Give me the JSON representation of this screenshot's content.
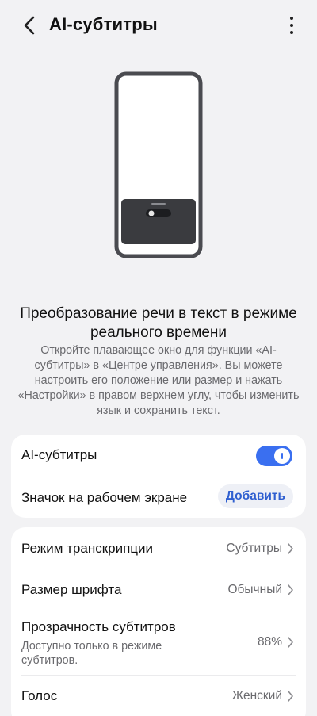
{
  "header": {
    "title": "AI-субтитры",
    "back_icon": "chevron-left-icon",
    "more_icon": "more-vertical-icon"
  },
  "intro": {
    "heading": "Преобразование речи в текст в режиме реального времени",
    "description": "Откройте плавающее окно для функции «AI-субтитры» в «Центре управления». Вы можете настроить его положение или размер и нажать «Настройки» в правом верхнем углу, чтобы изменить язык и сохранить текст."
  },
  "card1": {
    "ai_subtitles": {
      "label": "AI-субтитры",
      "enabled": true
    },
    "home_icon": {
      "label": "Значок на рабочем экране",
      "button": "Добавить"
    }
  },
  "card2": {
    "items": [
      {
        "label": "Режим транскрипции",
        "value": "Субтитры"
      },
      {
        "label": "Размер шрифта",
        "value": "Обычный"
      },
      {
        "label": "Прозрачность субтитров",
        "sublabel": "Доступно только в режиме субтитров.",
        "value": "88%"
      },
      {
        "label": "Голос",
        "value": "Женский"
      }
    ]
  },
  "colors": {
    "accent": "#3a6ff0",
    "background": "#f2f2f4",
    "card": "#ffffff"
  }
}
